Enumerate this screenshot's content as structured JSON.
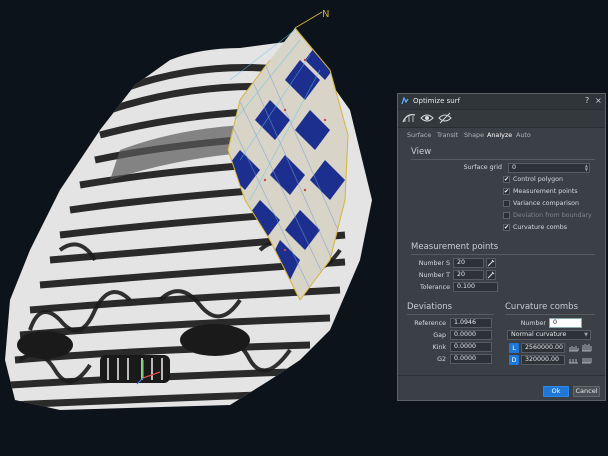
{
  "viewport": {
    "north_label": "N",
    "colors": {
      "background": "#0c131b",
      "zebra_dark": "#2a2a2a",
      "zebra_light": "#e6e6e6",
      "analysis_blue": "#1c2f8f"
    }
  },
  "dialog": {
    "title": "Optimize surf",
    "help_label": "?",
    "close_label": "×",
    "toolbar": [
      {
        "icon": "surface-tool-icon"
      },
      {
        "icon": "eye-icon"
      },
      {
        "icon": "eye-hidden-icon"
      }
    ],
    "tabs": [
      {
        "label": "Surface",
        "active": false
      },
      {
        "label": "Transit",
        "active": false
      },
      {
        "label": "Shape",
        "active": false
      },
      {
        "label": "Analyze",
        "active": true
      },
      {
        "label": "Auto",
        "active": false
      }
    ],
    "view": {
      "title": "View",
      "surface_grid_label": "Surface grid",
      "surface_grid_value": "0",
      "checkboxes": [
        {
          "label": "Control polygon",
          "checked": true,
          "enabled": true
        },
        {
          "label": "Measurement points",
          "checked": true,
          "enabled": true
        },
        {
          "label": "Variance comparison",
          "checked": false,
          "enabled": true
        },
        {
          "label": "Deviation from boundary",
          "checked": false,
          "enabled": false
        },
        {
          "label": "Curvature combs",
          "checked": true,
          "enabled": true
        }
      ]
    },
    "measurement": {
      "title": "Measurement points",
      "number_s_label": "Number S",
      "number_s_value": "20",
      "number_t_label": "Number T",
      "number_t_value": "20",
      "tolerance_label": "Tolerance",
      "tolerance_value": "0.100"
    },
    "deviations": {
      "title": "Deviations",
      "rows": [
        {
          "label": "Reference",
          "value": "1.0946"
        },
        {
          "label": "Gap",
          "value": "0.0000"
        },
        {
          "label": "Kink",
          "value": "0.0000"
        },
        {
          "label": "G2",
          "value": "0.0000"
        }
      ]
    },
    "curvature": {
      "title": "Curvature combs",
      "number_label": "Number",
      "number_value": "0",
      "type_value": "Normal curvature",
      "l_badge": "L",
      "l_value": "2560000.00",
      "d_badge": "D",
      "d_value": "320000.00"
    },
    "ok_label": "Ok",
    "cancel_label": "Cancel"
  }
}
